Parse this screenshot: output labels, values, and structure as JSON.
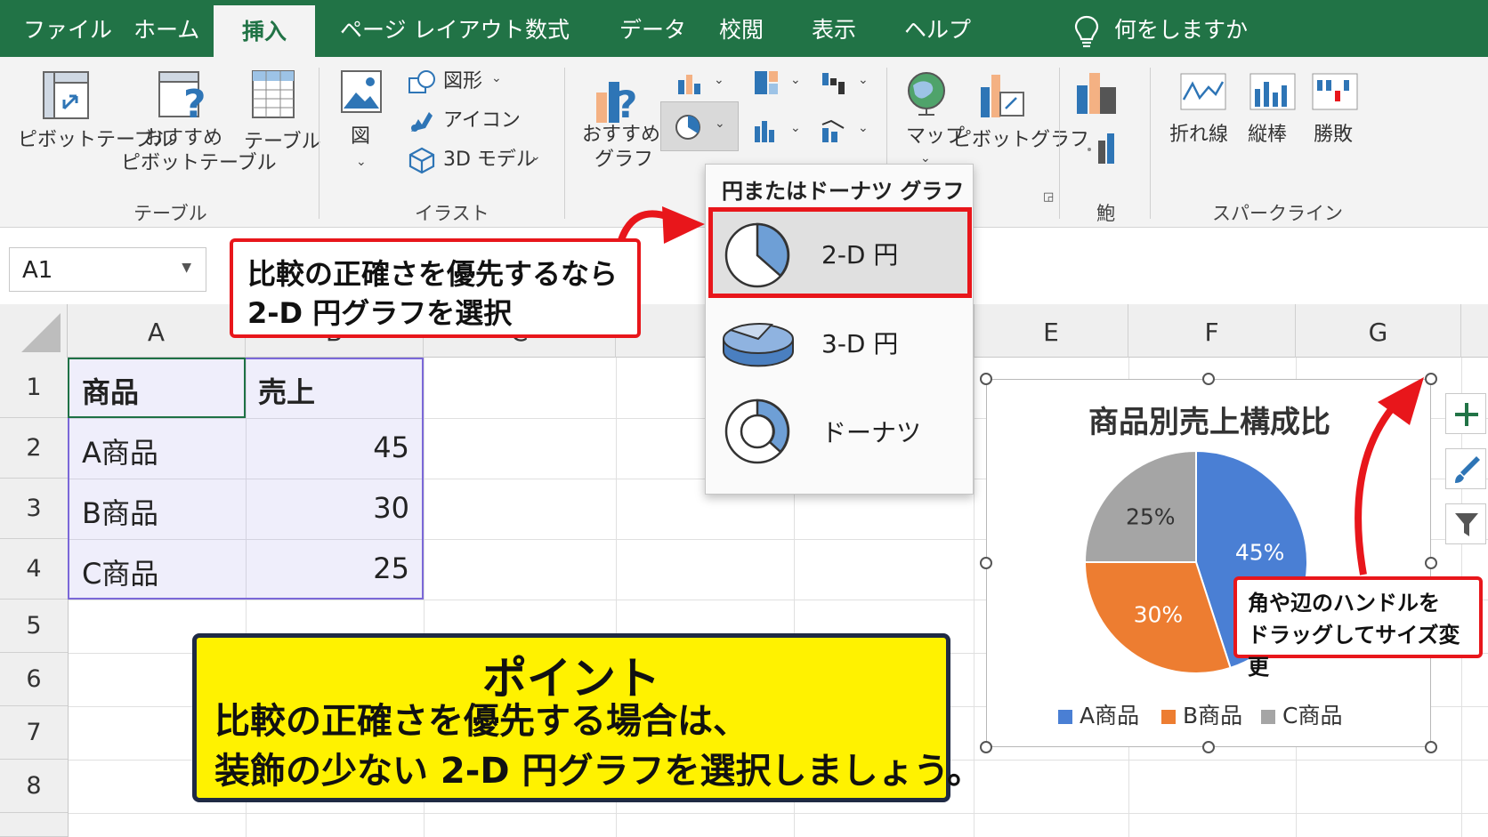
{
  "menu": {
    "tabs": [
      "ファイル",
      "ホーム",
      "挿入",
      "ページ レイアウト",
      "数式",
      "データ",
      "校閲",
      "表示",
      "ヘルプ"
    ],
    "active_tab": "挿入",
    "tell_me": "何をしますか"
  },
  "ribbon": {
    "pivot_table": "ピボットテーブル",
    "recommended_pivot_1": "おすすめ",
    "recommended_pivot_2": "ピボットテーブル",
    "table": "テーブル",
    "group_table": "テーブル",
    "picture": "図",
    "shapes": "図形",
    "icons": "アイコン",
    "models_3d": "3D モデル",
    "group_illust": "イラスト",
    "recommended_chart_1": "おすすめ",
    "recommended_chart_2": "グラフ",
    "map": "マップ",
    "pivot_chart": "ピボットグラフ",
    "group_tour": "鮑",
    "spark_line": "折れ線",
    "spark_column": "縦棒",
    "spark_winloss": "勝敗",
    "group_sparkline": "スパークライン"
  },
  "namebox": {
    "value": "A1"
  },
  "grid": {
    "columns": [
      "A",
      "B",
      "C",
      "E",
      "F",
      "G"
    ],
    "rows": [
      "1",
      "2",
      "3",
      "4",
      "5",
      "6",
      "7",
      "8"
    ],
    "cells": {
      "a1": "商品",
      "b1": "売上",
      "a2": "A商品",
      "b2": "45",
      "a3": "B商品",
      "b3": "30",
      "a4": "C商品",
      "b4": "25"
    }
  },
  "dropdown": {
    "title": "円またはドーナツ グラフ",
    "items": [
      "2-D 円",
      "3-D 円",
      "ドーナツ"
    ],
    "selected": "2-D 円"
  },
  "callouts": {
    "compare_line1": "比較の正確さを優先するなら",
    "compare_line2": "2-D 円グラフを選択",
    "resize_line1": "角や辺のハンドルを",
    "resize_line2": "ドラッグしてサイズ変更"
  },
  "point": {
    "title": "ポイント",
    "line1": "比較の正確さを優先する場合は、",
    "line2": "装飾の少ない 2-D 円グラフを選択しましょう。"
  },
  "colors": {
    "excel_green": "#217346",
    "highlight_red": "#e8161b",
    "point_yellow": "#fff200",
    "series_a": "#4a7fd4",
    "series_b": "#ed7d31",
    "series_c": "#a5a5a5"
  },
  "chart_data": {
    "type": "pie",
    "title": "商品別売上構成比",
    "categories": [
      "A商品",
      "B商品",
      "C商品"
    ],
    "values": [
      45,
      30,
      25
    ],
    "labels": [
      "45%",
      "30%",
      "25%"
    ],
    "colors": [
      "#4a7fd4",
      "#ed7d31",
      "#a5a5a5"
    ],
    "legend": "bottom"
  }
}
